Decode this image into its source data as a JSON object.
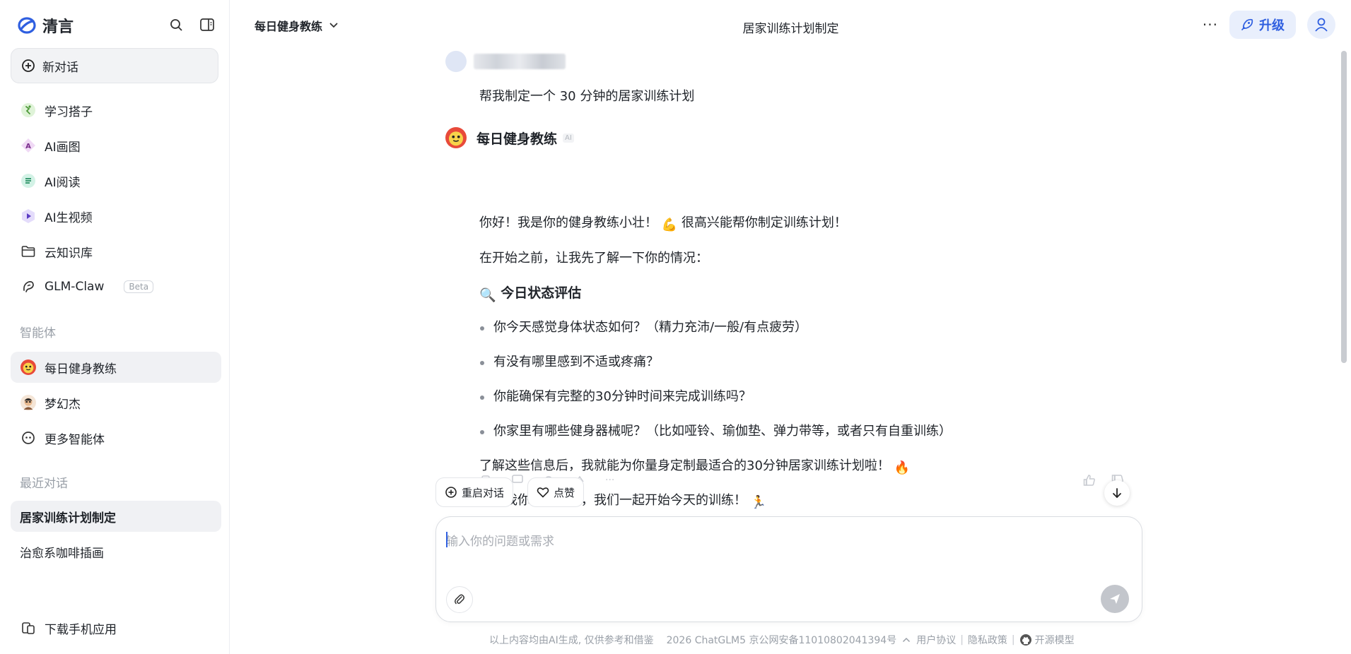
{
  "brand": {
    "name": "清言",
    "accent": "#2f5fe0"
  },
  "sidebar": {
    "new_chat": "新对话",
    "items": [
      {
        "label": "学习搭子",
        "icon": "study-buddy-icon"
      },
      {
        "label": "AI画图",
        "icon": "ai-draw-icon"
      },
      {
        "label": "AI阅读",
        "icon": "ai-read-icon"
      },
      {
        "label": "AI生视频",
        "icon": "ai-video-icon"
      },
      {
        "label": "云知识库",
        "icon": "folder-icon"
      },
      {
        "label": "GLM-Claw",
        "icon": "claw-icon",
        "badge": "Beta"
      }
    ],
    "agents_label": "智能体",
    "agents": [
      {
        "label": "每日健身教练",
        "active": true
      },
      {
        "label": "梦幻杰"
      },
      {
        "label": "更多智能体"
      }
    ],
    "recent_label": "最近对话",
    "recent": [
      {
        "label": "居家训练计划制定",
        "active": true
      },
      {
        "label": "治愈系咖啡插画"
      }
    ],
    "download": "下载手机应用"
  },
  "header": {
    "agent": "每日健身教练",
    "title": "居家训练计划制定",
    "more": "···",
    "upgrade": "升级"
  },
  "chat": {
    "user_message": "帮我制定一个 30 分钟的居家训练计划",
    "bot_name": "每日健身教练",
    "ai_tag": "AI",
    "intro": "你好！我是你的健身教练小壮！",
    "intro_emoji": "💪",
    "intro_after": "很高兴能帮你制定训练计划！",
    "line2": "在开始之前，让我先了解一下你的情况：",
    "section_emoji": "🔍",
    "section_title": "今日状态评估",
    "bullets": [
      "你今天感觉身体状态如何？（精力充沛/一般/有点疲劳）",
      "有没有哪里感到不适或疼痛？",
      "你能确保有完整的30分钟时间来完成训练吗？",
      "你家里有哪些健身器械呢？（比如哑铃、瑜伽垫、弹力带等，或者只有自重训练）"
    ],
    "after": "了解这些信息后，我就能为你量身定制最适合的30分钟居家训练计划啦！",
    "after_emoji": "🔥",
    "closing": "告诉我你的情况吧，我们一起开始今天的训练！",
    "closing_emoji": "🏃",
    "restart": "重启对话",
    "like": "点赞"
  },
  "composer": {
    "placeholder": "输入你的问题或需求"
  },
  "footer": {
    "disclaimer": "以上内容均由AI生成, 仅供参考和借鉴",
    "icp": "2026 ChatGLM5 京公网安备11010802041394号",
    "terms": "用户协议",
    "privacy": "隐私政策",
    "open_source": "开源模型"
  }
}
